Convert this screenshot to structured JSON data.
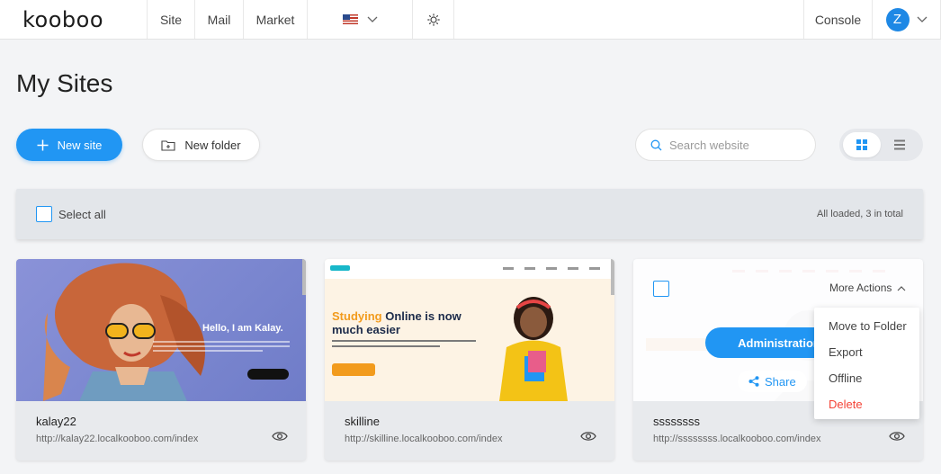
{
  "brand": {
    "logo_text": "kooboo"
  },
  "nav": {
    "site": "Site",
    "mail": "Mail",
    "market": "Market",
    "language_flag": "us-flag-icon",
    "theme_icon": "sun-icon",
    "console": "Console",
    "user_initial": "Z"
  },
  "page": {
    "title": "My Sites"
  },
  "toolbar": {
    "new_site": "New site",
    "new_folder": "New folder",
    "search_placeholder": "Search website",
    "views": [
      "grid-view-icon",
      "list-view-icon"
    ],
    "active_view": "grid"
  },
  "selection_bar": {
    "select_all": "Select all",
    "status": "All loaded, 3 in total"
  },
  "sites": [
    {
      "name": "kalay22",
      "url": "http://kalay22.localkooboo.com/index",
      "preview_headline": "Hello, I am Kalay."
    },
    {
      "name": "skilline",
      "url": "http://skilline.localkooboo.com/index",
      "preview_headline": "Studying",
      "preview_headline_rest": "Online is now much easier"
    },
    {
      "name": "ssssssss",
      "url": "http://ssssssss.localkooboo.com/index"
    }
  ],
  "hover_card": {
    "more_actions": "More Actions",
    "administration": "Administration",
    "share": "Share"
  },
  "more_actions_menu": [
    "Move to Folder",
    "Export",
    "Offline",
    "Delete"
  ],
  "colors": {
    "accent": "#2196f3",
    "danger": "#f44336",
    "background": "#f3f4f6"
  }
}
